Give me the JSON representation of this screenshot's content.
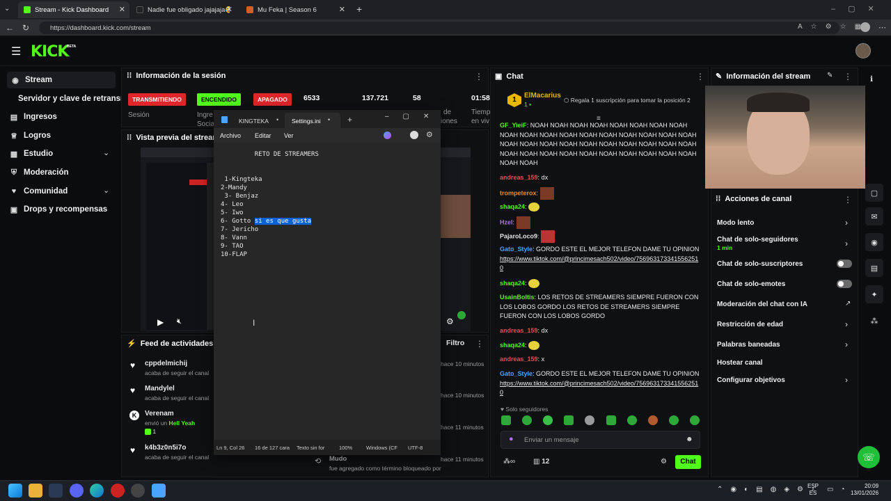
{
  "browser": {
    "tabs": [
      {
        "title": "Stream - Kick Dashboard",
        "color": "#53fc18"
      },
      {
        "title": "Nadie fue obligado jajajaja😂 | TikTok",
        "color": "#222222"
      },
      {
        "title": "Mu Feka | Season 6",
        "color": "#d0602a"
      }
    ],
    "url": "https://dashboard.kick.com/stream"
  },
  "brand": {
    "logo": "KICK",
    "beta": "BETA",
    "accent": "#53fc18"
  },
  "sidebar": {
    "items": [
      {
        "label": "Stream",
        "icon": "stream-icon"
      },
      {
        "label": "Servidor y clave de retransmisión",
        "icon": ""
      },
      {
        "label": "Ingresos",
        "icon": "revenue-icon"
      },
      {
        "label": "Logros",
        "icon": "trophy-icon"
      },
      {
        "label": "Estudio",
        "icon": "studio-icon"
      },
      {
        "label": "Moderación",
        "icon": "shield-icon"
      },
      {
        "label": "Comunidad",
        "icon": "community-icon"
      },
      {
        "label": "Drops y recompensas",
        "icon": "drops-icon"
      }
    ]
  },
  "session": {
    "title": "Información de la sesión",
    "badges": {
      "live": "TRANSMITIENDO",
      "on": "ENCENDIDO",
      "off": "APAGADO"
    },
    "stats": [
      "6533",
      "137.721",
      "58",
      "01:58"
    ],
    "labels": [
      "Sesión",
      "Ingre",
      "Socia",
      "de",
      "iones",
      "Tiemp",
      "en viv"
    ]
  },
  "preview": {
    "title": "Vista previa del stream"
  },
  "feed": {
    "title": "Feed de actividades",
    "filter": "Filtro",
    "items": [
      {
        "user": "cppdelmichij",
        "action": "acaba de seguir el canal",
        "time": "hace 10 minutos"
      },
      {
        "user": "Mandylel",
        "action": "acaba de seguir el canal",
        "time": "hace 10 minutos"
      },
      {
        "user": "Verenam",
        "action": "envió un",
        "gift": "Hell Yeah",
        "count": "1",
        "time": "hace 11 minutos"
      },
      {
        "user": "k4b3z0n5i7o",
        "action": "acaba de seguir el canal",
        "time": "hace 11 minutos"
      }
    ],
    "mod_item": {
      "title": "Mudo",
      "text": "fue agregado como término bloqueado por"
    }
  },
  "notepad": {
    "tabs": [
      "KINGTEKA",
      "Settings.ini"
    ],
    "menu": [
      "Archivo",
      "Editar",
      "Ver"
    ],
    "lines": [
      "         RETO DE STREAMERS",
      "",
      "",
      " 1-Kingteka",
      "2-Mandy",
      " 3- Benjaz",
      "4- Leo",
      "5- Iwo",
      "6- Gotto ",
      "7- Jericho",
      "8- Vann",
      "9- TAO",
      "10-FLAP"
    ],
    "selected": "si es que gusta",
    "status": [
      "Ln 9, Col 26",
      "16 de 127 cara",
      "Texto sin for",
      "100%",
      "Windows (CF",
      "UTF-8"
    ]
  },
  "chat": {
    "title": "Chat",
    "pinned": {
      "user": "ElMacarius",
      "rank": "1",
      "text": "Regala 1 suscripción para tomar la posición 2"
    },
    "messages": [
      {
        "user": "GF_YieiF",
        "color": "#53fc18",
        "text": "NOAH NOAH NOAH NOAH NOAH NOAH NOAH NOAH NOAH NOAH NOAH NOAH NOAH NOAH NOAH NOAH NOAH NOAH NOAH NOAH NOAH NOAH NOAH NOAH NOAH NOAH NOAH NOAH NOAH NOAH NOAH NOAH NOAH NOAH NOAH NOAH NOAH NOAH NOAH NOAH"
      },
      {
        "user": "andreas_159",
        "color": "#e05050",
        "text": "dx"
      },
      {
        "user": "trompeterox",
        "color": "#f08a24",
        "text": ""
      },
      {
        "user": "shaqa24",
        "color": "#53fc18",
        "text": ""
      },
      {
        "user": "Hzel",
        "color": "#b06bff",
        "text": ""
      },
      {
        "user": "PajaroLoco9",
        "color": "#e0e0e0",
        "text": ""
      },
      {
        "user": "Gato_Style",
        "color": "#4aa3ff",
        "text": "GORDO ESTE EL MEJOR TELEFON DAME TU OPINION",
        "link": "https://www.tiktok.com/@princimesach502/video/7569631733415562510"
      },
      {
        "user": "shaqa24",
        "color": "#53fc18",
        "text": ""
      },
      {
        "user": "UsainBoltis",
        "color": "#53fc18",
        "text": "LOS RETOS DE STREAMERS SIEMPRE FUERON CON LOS LOBOS GORDO LOS RETOS DE STREAMERS SIEMPRE FUERON CON LOS LOBOS GORDO"
      },
      {
        "user": "andreas_159",
        "color": "#e05050",
        "text": "dx"
      },
      {
        "user": "shaqa24",
        "color": "#53fc18",
        "text": ""
      },
      {
        "user": "andreas_159",
        "color": "#e05050",
        "text": "x"
      },
      {
        "user": "Gato_Style",
        "color": "#4aa3ff",
        "text": "GORDO ESTE EL MEJOR TELEFON DAME TU OPINION",
        "link": "https://www.tiktok.com/@princimesach502/video/7569631733415562510"
      }
    ],
    "mode": "Solo seguidores",
    "placeholder": "Enviar un mensaje",
    "viewers": "12",
    "send": "Chat"
  },
  "stream_info": {
    "title": "Información del stream",
    "actions_title": "Acciones de canal",
    "actions": [
      {
        "label": "Modo lento",
        "control": "chevron"
      },
      {
        "label": "Chat de solo-seguidores",
        "sub": "1 min",
        "control": "chevron"
      },
      {
        "label": "Chat de solo-suscriptores",
        "control": "toggle"
      },
      {
        "label": "Chat de solo-emotes",
        "control": "toggle"
      },
      {
        "label": "Moderación del chat con IA",
        "control": "external"
      },
      {
        "label": "Restricción de edad",
        "control": "chevron"
      },
      {
        "label": "Palabras baneadas",
        "control": "chevron"
      },
      {
        "label": "Hostear canal",
        "control": "none"
      },
      {
        "label": "Configurar objetivos",
        "control": "chevron"
      }
    ]
  },
  "taskbar": {
    "lang": "ESP",
    "region": "ES",
    "time": "20:09",
    "date": "13/01/2026"
  }
}
